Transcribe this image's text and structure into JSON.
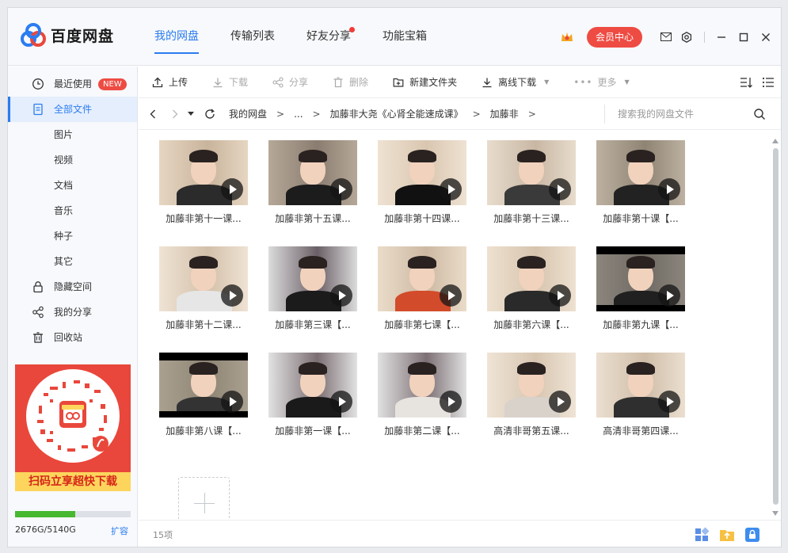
{
  "app": {
    "logo_text": "百度网盘"
  },
  "nav": [
    {
      "label": "我的网盘",
      "active": true
    },
    {
      "label": "传输列表"
    },
    {
      "label": "好友分享",
      "has_dot": true
    },
    {
      "label": "功能宝箱"
    }
  ],
  "header": {
    "vip_label": "会员中心"
  },
  "sidebar": {
    "items": [
      {
        "label": "最近使用",
        "badge": "NEW",
        "icon": "clock-icon"
      },
      {
        "label": "全部文件",
        "active": true,
        "icon": "file-icon"
      },
      {
        "label": "图片"
      },
      {
        "label": "视频"
      },
      {
        "label": "文档"
      },
      {
        "label": "音乐"
      },
      {
        "label": "种子"
      },
      {
        "label": "其它"
      },
      {
        "label": "隐藏空间",
        "icon": "lock-icon"
      },
      {
        "label": "我的分享",
        "icon": "share-icon"
      },
      {
        "label": "回收站",
        "icon": "trash-icon"
      }
    ],
    "promo_caption": "扫码立享超快下载",
    "storage": {
      "used_text": "2676G/5140G",
      "fraction": 0.52,
      "expand_label": "扩容"
    }
  },
  "toolbar": {
    "upload": "上传",
    "download": "下载",
    "share": "分享",
    "delete": "删除",
    "new_folder": "新建文件夹",
    "offline_download": "离线下载",
    "more": "更多"
  },
  "path": {
    "crumbs": [
      "我的网盘",
      "...",
      "加藤非大尧《心肾全能速成课》",
      "加藤非"
    ],
    "separator": ">",
    "search_placeholder": "搜索我的网盘文件"
  },
  "files": [
    {
      "name": "加藤非第十一课..."
    },
    {
      "name": "加藤非第十五课..."
    },
    {
      "name": "加藤非第十四课..."
    },
    {
      "name": "加藤非第十三课..."
    },
    {
      "name": "加藤非第十课【..."
    },
    {
      "name": "加藤非第十二课..."
    },
    {
      "name": "加藤非第三课【..."
    },
    {
      "name": "加藤非第七课【..."
    },
    {
      "name": "加藤非第六课【..."
    },
    {
      "name": "加藤非第九课【..."
    },
    {
      "name": "加藤非第八课【..."
    },
    {
      "name": "加藤非第一课【..."
    },
    {
      "name": "加藤非第二课【..."
    },
    {
      "name": "高清非哥第五课..."
    },
    {
      "name": "高清非哥第四课..."
    }
  ],
  "status": {
    "item_count": "15项"
  },
  "colors": {
    "accent": "#2b7cf1",
    "vip": "#ee4b43",
    "storage": "#47b830"
  }
}
